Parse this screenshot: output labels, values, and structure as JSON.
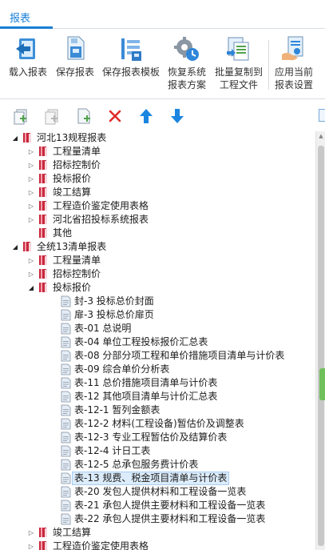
{
  "ribbon_tab": {
    "label": "报表"
  },
  "ribbon": {
    "buttons": [
      {
        "label": "载入报表",
        "icon": "load-report-icon"
      },
      {
        "label": "保存报表",
        "icon": "save-report-icon"
      },
      {
        "label": "保存报表模板",
        "icon": "save-template-icon"
      },
      {
        "label_line1": "恢复系统",
        "label_line2": "报表方案",
        "icon": "restore-system-icon"
      },
      {
        "label_line1": "批量复制到",
        "label_line2": "工程文件",
        "icon": "batch-copy-icon"
      },
      {
        "label_line1": "应用当前",
        "label_line2": "报表设置",
        "icon": "apply-settings-icon"
      }
    ]
  },
  "tree_toolbar": {
    "icons": [
      "add-report-icon",
      "add-folder-icon",
      "new-doc-icon",
      "delete-icon",
      "move-up-icon",
      "move-down-icon"
    ],
    "colors": {
      "delete": "#e02b2b",
      "arrow": "#1a86e0"
    }
  },
  "tree": {
    "rows": [
      {
        "text": "河北13规程报表",
        "level": 0,
        "state": "open",
        "type": "book"
      },
      {
        "text": "工程量清单",
        "level": 1,
        "state": "closed",
        "type": "book"
      },
      {
        "text": "招标控制价",
        "level": 1,
        "state": "closed",
        "type": "book"
      },
      {
        "text": "投标报价",
        "level": 1,
        "state": "closed",
        "type": "book"
      },
      {
        "text": "竣工结算",
        "level": 1,
        "state": "closed",
        "type": "book"
      },
      {
        "text": "工程造价鉴定使用表格",
        "level": 1,
        "state": "closed",
        "type": "book"
      },
      {
        "text": "河北省招投标系统报表",
        "level": 1,
        "state": "closed",
        "type": "book"
      },
      {
        "text": "其他",
        "level": 1,
        "state": "none",
        "type": "book"
      },
      {
        "text": "全统13清单报表",
        "level": 0,
        "state": "open",
        "type": "book"
      },
      {
        "text": "工程量清单",
        "level": 1,
        "state": "closed",
        "type": "book"
      },
      {
        "text": "招标控制价",
        "level": 1,
        "state": "closed",
        "type": "book"
      },
      {
        "text": "投标报价",
        "level": 1,
        "state": "open",
        "type": "book"
      },
      {
        "text": "封-3 投标总价封面",
        "level": 2,
        "state": "none",
        "type": "doc"
      },
      {
        "text": "扉-3 投标总价扉页",
        "level": 2,
        "state": "none",
        "type": "doc"
      },
      {
        "text": "表-01 总说明",
        "level": 2,
        "state": "none",
        "type": "doc"
      },
      {
        "text": "表-04 单位工程投标报价汇总表",
        "level": 2,
        "state": "none",
        "type": "doc"
      },
      {
        "text": "表-08 分部分项工程和单价措施项目清单与计价表",
        "level": 2,
        "state": "none",
        "type": "doc"
      },
      {
        "text": "表-09 综合单价分析表",
        "level": 2,
        "state": "none",
        "type": "doc"
      },
      {
        "text": "表-11 总价措施项目清单与计价表",
        "level": 2,
        "state": "none",
        "type": "doc"
      },
      {
        "text": "表-12 其他项目清单与计价汇总表",
        "level": 2,
        "state": "none",
        "type": "doc"
      },
      {
        "text": "表-12-1 暂列金额表",
        "level": 2,
        "state": "none",
        "type": "doc"
      },
      {
        "text": "表-12-2 材料(工程设备)暂估价及调整表",
        "level": 2,
        "state": "none",
        "type": "doc"
      },
      {
        "text": "表-12-3 专业工程暂估价及结算价表",
        "level": 2,
        "state": "none",
        "type": "doc"
      },
      {
        "text": "表-12-4 计日工表",
        "level": 2,
        "state": "none",
        "type": "doc"
      },
      {
        "text": "表-12-5 总承包服务费计价表",
        "level": 2,
        "state": "none",
        "type": "doc"
      },
      {
        "text": "表-13 规费、税金项目清单与计价表",
        "level": 2,
        "state": "none",
        "type": "doc",
        "selected": true
      },
      {
        "text": "表-20 发包人提供材料和工程设备一览表",
        "level": 2,
        "state": "none",
        "type": "doc"
      },
      {
        "text": "表-21 承包人提供主要材料和工程设备一览表",
        "level": 2,
        "state": "none",
        "type": "doc"
      },
      {
        "text": "表-22 承包人提供主要材料和工程设备一览表",
        "level": 2,
        "state": "none",
        "type": "doc"
      },
      {
        "text": "竣工结算",
        "level": 1,
        "state": "closed",
        "type": "book"
      },
      {
        "text": "工程造价鉴定使用表格",
        "level": 1,
        "state": "closed",
        "type": "book"
      }
    ]
  },
  "colors": {
    "accent": "#1a7fd6",
    "book_red": "#c8283c",
    "book_pink": "#f2a0ae",
    "doc_fill": "#e6edf5",
    "doc_stroke": "#7f8fa3",
    "selection": "#dcecfb"
  }
}
